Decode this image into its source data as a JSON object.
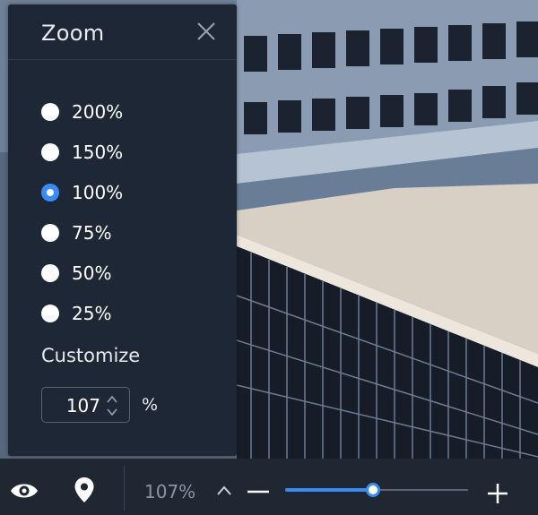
{
  "zoom_panel": {
    "title": "Zoom",
    "options": [
      {
        "label": "200%",
        "checked": false
      },
      {
        "label": "150%",
        "checked": false
      },
      {
        "label": "100%",
        "checked": true
      },
      {
        "label": "75%",
        "checked": false
      },
      {
        "label": "50%",
        "checked": false
      },
      {
        "label": "25%",
        "checked": false
      }
    ],
    "customize_label": "Customize",
    "custom_value": "107",
    "unit": "%"
  },
  "toolbar": {
    "zoom_readout": "107%",
    "slider_level": 0.48
  },
  "colors": {
    "panel_bg": "#1e2735",
    "accent": "#3b8bf6",
    "toolbar_bg": "#1f2732"
  },
  "icons": [
    "close-icon",
    "eye-icon",
    "location-pin-icon",
    "chevron-up-icon",
    "minus-icon",
    "plus-icon",
    "spinner-icon"
  ]
}
